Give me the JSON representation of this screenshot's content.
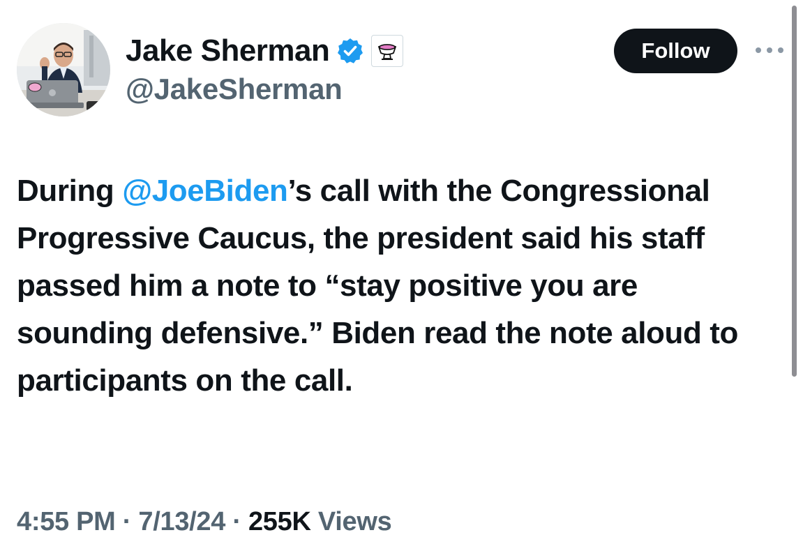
{
  "author": {
    "display_name": "Jake Sherman",
    "handle": "@JakeSherman",
    "verified": true,
    "avatar_icon": "profile-photo",
    "affiliate_badge_icon": "punchbowl-logo"
  },
  "actions": {
    "follow_label": "Follow",
    "more_icon": "ellipsis-icon"
  },
  "tweet": {
    "text_before_mention": "During ",
    "mention": "@JoeBiden",
    "text_after_mention": "’s call with the Congressional Progressive Caucus, the president said his staff passed him a note to “stay positive you are sounding defensive.” Biden read the note aloud to participants on the call."
  },
  "meta": {
    "time": "4:55 PM",
    "separator": " · ",
    "date": "7/13/24",
    "views_count": "255K",
    "views_label": " Views"
  },
  "colors": {
    "text": "#0f1419",
    "secondary": "#536471",
    "link": "#1d9bf0",
    "verified": "#1d9bf0",
    "follow_bg": "#0f1419"
  }
}
